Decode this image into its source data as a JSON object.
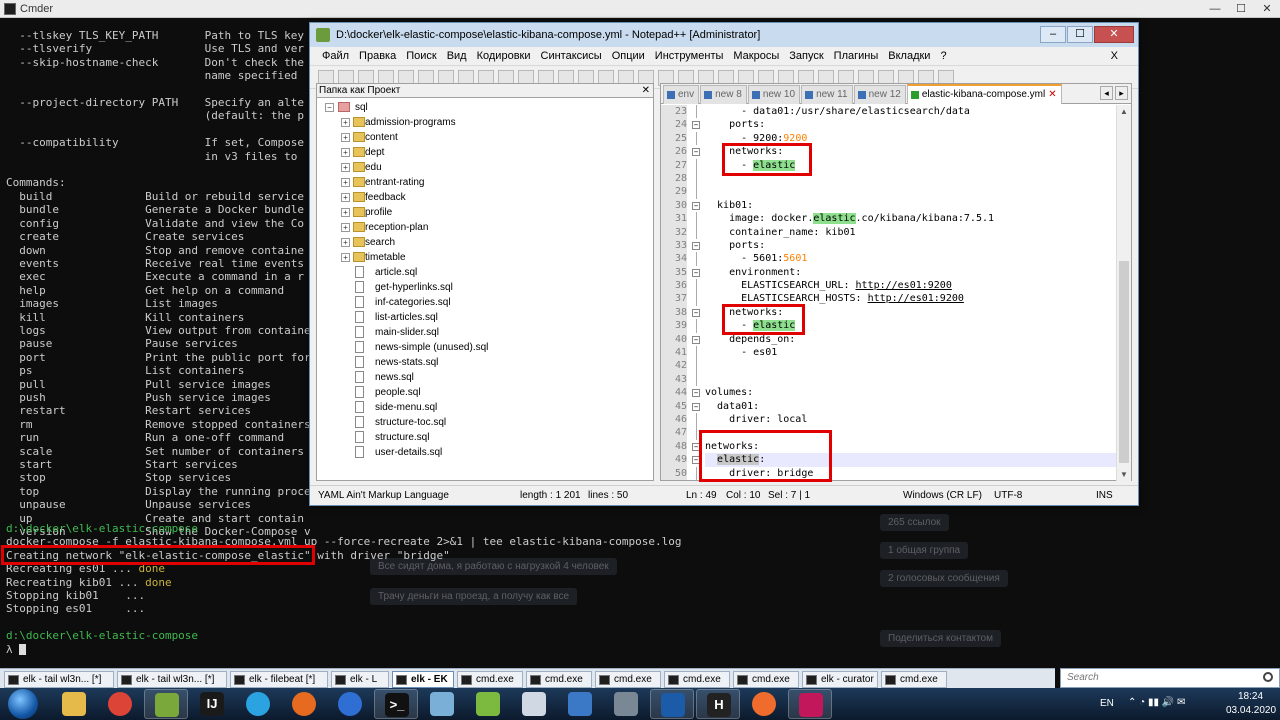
{
  "cmder": {
    "title": "Cmder",
    "help_lines": [
      "  --tlskey TLS_KEY_PATH       Path to TLS key",
      "  --tlsverify                 Use TLS and ver",
      "  --skip-hostname-check       Don't check the",
      "                              name specified ",
      "",
      "  --project-directory PATH    Specify an alte",
      "                              (default: the p",
      "",
      "  --compatibility             If set, Compose",
      "                              in v3 files to ",
      "",
      "Commands:",
      "  build              Build or rebuild service",
      "  bundle             Generate a Docker bundle",
      "  config             Validate and view the Co",
      "  create             Create services",
      "  down               Stop and remove containe",
      "  events             Receive real time events",
      "  exec               Execute a command in a r",
      "  help               Get help on a command",
      "  images             List images",
      "  kill               Kill containers",
      "  logs               View output from containe",
      "  pause              Pause services",
      "  port               Print the public port for",
      "  ps                 List containers",
      "  pull               Pull service images",
      "  push               Push service images",
      "  restart            Restart services",
      "  rm                 Remove stopped containers",
      "  run                Run a one-off command",
      "  scale              Set number of containers",
      "  start              Start services",
      "  stop               Stop services",
      "  top                Display the running proce",
      "  unpause            Unpause services",
      "  up                 Create and start contain",
      "  version            Show the Docker-Compose v"
    ],
    "prompt_path": "d:\\docker\\elk-elastic-compose",
    "command": "docker-compose -f elastic-kibana-compose.yml up --force-recreate 2>&1 | tee elastic-kibana-compose.log",
    "output": [
      {
        "text": "Creating network \"elk-elastic-compose_elastic\" with driver \"bridge\"",
        "status": ""
      },
      {
        "text": "Recreating es01 ... ",
        "status": "done"
      },
      {
        "text": "Recreating kib01 ... ",
        "status": "done"
      },
      {
        "text": "Stopping kib01    ...",
        "status": ""
      },
      {
        "text": "Stopping es01     ...",
        "status": ""
      }
    ],
    "prompt_path2": "d:\\docker\\elk-elastic-compose",
    "prompt_symbol": "λ"
  },
  "background_chat": {
    "messages": [
      "Все сидят дома, я работаю с нагрузкой 4 человек",
      "Трачу деньги на проезд, а получу как все",
      "265 ссылок",
      "1 общая группа",
      "2 голосовых сообщения",
      "Поделиться контактом"
    ]
  },
  "notepad": {
    "title": "D:\\docker\\elk-elastic-compose\\elastic-kibana-compose.yml - Notepad++ [Administrator]",
    "menu": [
      "Файл",
      "Правка",
      "Поиск",
      "Вид",
      "Кодировки",
      "Синтаксисы",
      "Опции",
      "Инструменты",
      "Макросы",
      "Запуск",
      "Плагины",
      "Вкладки",
      "?"
    ],
    "menu_close": "X",
    "panel_title": "Папка как Проект",
    "tree_root": "sql",
    "folders": [
      "admission-programs",
      "content",
      "dept",
      "edu",
      "entrant-rating",
      "feedback",
      "profile",
      "reception-plan",
      "search",
      "timetable"
    ],
    "files": [
      "article.sql",
      "get-hyperlinks.sql",
      "inf-categories.sql",
      "list-articles.sql",
      "main-slider.sql",
      "news-simple (unused).sql",
      "news-stats.sql",
      "news.sql",
      "people.sql",
      "side-menu.sql",
      "structure-toc.sql",
      "structure.sql",
      "user-details.sql"
    ],
    "tabs": [
      "env",
      "new 8",
      "new 10",
      "new 11",
      "new 12",
      "elastic-kibana-compose.yml"
    ],
    "active_tab": "elastic-kibana-compose.yml",
    "code_lines": [
      {
        "n": "23",
        "t": "      - data01:/usr/share/elasticsearch/data"
      },
      {
        "n": "24",
        "t": "    ports:"
      },
      {
        "n": "25",
        "t": "      - 9200:9200"
      },
      {
        "n": "26",
        "t": "    networks:"
      },
      {
        "n": "27",
        "t": "      - elastic"
      },
      {
        "n": "28",
        "t": ""
      },
      {
        "n": "29",
        "t": ""
      },
      {
        "n": "30",
        "t": "  kib01:"
      },
      {
        "n": "31",
        "t": "    image: docker.elastic.co/kibana/kibana:7.5.1"
      },
      {
        "n": "32",
        "t": "    container_name: kib01"
      },
      {
        "n": "33",
        "t": "    ports:"
      },
      {
        "n": "34",
        "t": "      - 5601:5601"
      },
      {
        "n": "35",
        "t": "    environment:"
      },
      {
        "n": "36",
        "t": "      ELASTICSEARCH_URL: http://es01:9200"
      },
      {
        "n": "37",
        "t": "      ELASTICSEARCH_HOSTS: http://es01:9200"
      },
      {
        "n": "38",
        "t": "    networks:"
      },
      {
        "n": "39",
        "t": "      - elastic"
      },
      {
        "n": "40",
        "t": "    depends_on:"
      },
      {
        "n": "41",
        "t": "      - es01"
      },
      {
        "n": "42",
        "t": ""
      },
      {
        "n": "43",
        "t": ""
      },
      {
        "n": "44",
        "t": "volumes:"
      },
      {
        "n": "45",
        "t": "  data01:"
      },
      {
        "n": "46",
        "t": "    driver: local"
      },
      {
        "n": "47",
        "t": ""
      },
      {
        "n": "48",
        "t": "networks:"
      },
      {
        "n": "49",
        "t": "  elastic:"
      },
      {
        "n": "50",
        "t": "    driver: bridge"
      }
    ],
    "status": {
      "language": "YAML Ain't Markup Language",
      "length": "length : 1 201",
      "lines": "lines : 50",
      "ln": "Ln : 49",
      "col": "Col : 10",
      "sel": "Sel : 7 | 1",
      "eol": "Windows (CR LF)",
      "encoding": "UTF-8",
      "mode": "INS"
    }
  },
  "console_tabs": [
    {
      "label": "elk - tail wl3n... [*]",
      "selected": false
    },
    {
      "label": "elk - tail wl3n... [*]",
      "selected": false
    },
    {
      "label": "elk - filebeat [*]",
      "selected": false
    },
    {
      "label": "elk - L",
      "selected": false
    },
    {
      "label": "elk - EK",
      "selected": true
    },
    {
      "label": "cmd.exe",
      "selected": false
    },
    {
      "label": "cmd.exe",
      "selected": false
    },
    {
      "label": "cmd.exe",
      "selected": false
    },
    {
      "label": "cmd.exe",
      "selected": false
    },
    {
      "label": "cmd.exe",
      "selected": false
    },
    {
      "label": "elk - curator",
      "selected": false
    },
    {
      "label": "cmd.exe",
      "selected": false
    }
  ],
  "search_placeholder": "Search",
  "taskbar": {
    "apps": [
      "explorer-icon",
      "chrome-icon",
      "notepadpp-icon",
      "intellij-icon",
      "telegram-icon",
      "firefox-icon",
      "maps-icon",
      "cmd-icon",
      "notepad-icon",
      "android-icon",
      "paint-icon",
      "remote-icon",
      "network-icon",
      "virtualbox-icon",
      "hibernate-icon",
      "postman-icon",
      "database-icon"
    ],
    "lang": "EN",
    "time": "18:24",
    "date": "03.04.2020"
  }
}
